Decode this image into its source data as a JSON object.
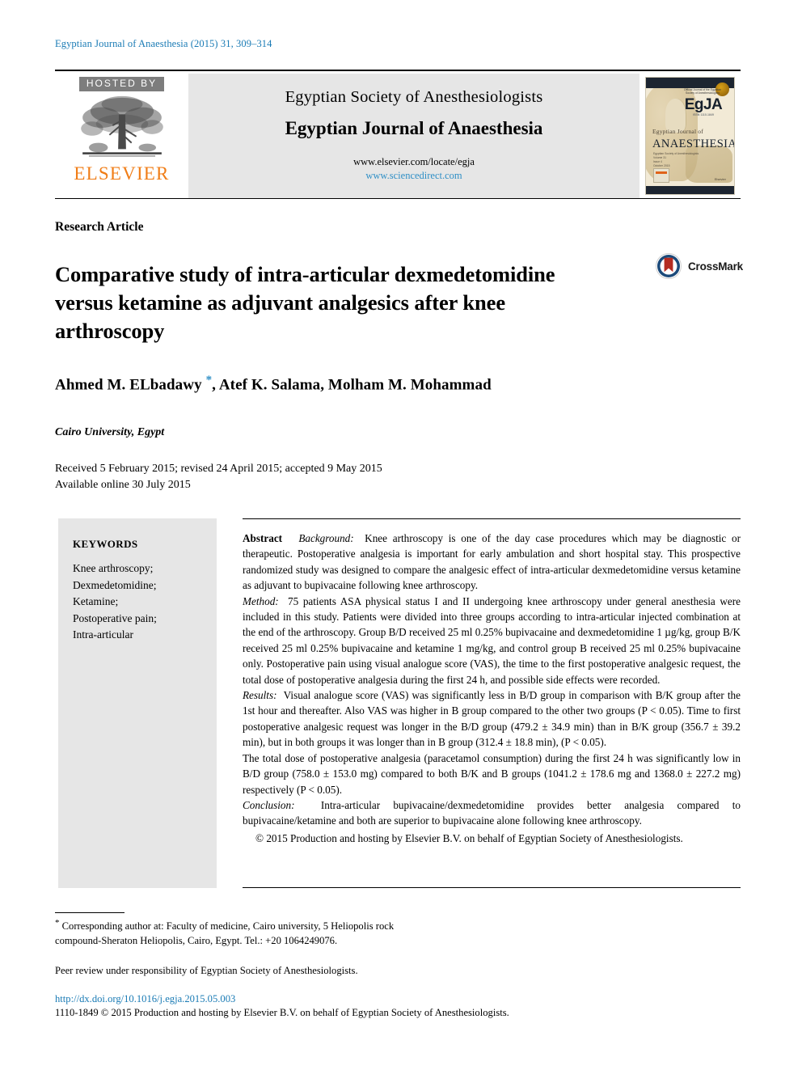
{
  "running_head": "Egyptian Journal of Anaesthesia (2015) 31, 309–314",
  "header": {
    "hosted_by": "HOSTED BY",
    "publisher_wordmark": "ELSEVIER",
    "society_name": "Egyptian Society of Anesthesiologists",
    "journal_name": "Egyptian Journal of Anaesthesia",
    "url_publisher": "www.elsevier.com/locate/egja",
    "url_platform": "www.sciencedirect.com",
    "cover": {
      "top_small": "Official Journal of the Egyptian Society of Anesthesiologists",
      "logo": "EgJA",
      "logo_sub": "ISSN 1110-1849",
      "title_line": "Egyptian Journal of",
      "title_main": "ANAESTHESIA",
      "meta_lines": "Egyptian Society of Anesthesiologists\nVolume 31\nIssue 4\nOctober 2015",
      "publisher_mini": "Elsevier"
    }
  },
  "article": {
    "type": "Research Article",
    "title": "Comparative study of intra-articular dexmedetomidine versus ketamine as adjuvant analgesics after knee arthroscopy",
    "crossmark_label": "CrossMark",
    "authors": "Ahmed M. ELbadawy ",
    "authors_rest": ", Atef K. Salama, Molham M. Mohammad",
    "corresponding_marker": "*",
    "affiliation": "Cairo University, Egypt",
    "history_received": "Received 5 February 2015; revised 24 April 2015; accepted 9 May 2015",
    "history_online": "Available online 30 July 2015"
  },
  "keywords": {
    "heading": "KEYWORDS",
    "items": [
      "Knee arthroscopy;",
      "Dexmedetomidine;",
      "Ketamine;",
      "Postoperative pain;",
      "Intra-articular"
    ]
  },
  "abstract": {
    "label": "Abstract",
    "background_label": "Background:",
    "background_text": "Knee arthroscopy is one of the day case procedures which may be diagnostic or therapeutic. Postoperative analgesia is important for early ambulation and short hospital stay. This prospective randomized study was designed to compare the analgesic effect of intra-articular dexmedetomidine versus ketamine as adjuvant to bupivacaine following knee arthroscopy.",
    "method_label": "Method:",
    "method_text": "75 patients ASA physical status I and II undergoing knee arthroscopy under general anesthesia were included in this study. Patients were divided into three groups according to intra-articular injected combination at the end of the arthroscopy. Group B/D received 25 ml 0.25% bupivacaine and dexmedetomidine 1 µg/kg, group B/K received 25 ml 0.25% bupivacaine and ketamine 1 mg/kg, and control group B received 25 ml 0.25% bupivacaine only. Postoperative pain using visual analogue score (VAS), the time to the first postoperative analgesic request, the total dose of postoperative analgesia during the first 24 h, and possible side effects were recorded.",
    "results_label": "Results:",
    "results_text": "Visual analogue score (VAS) was significantly less in B/D group in comparison with B/K group after the 1st hour and thereafter. Also VAS was higher in B group compared to the other two groups (P < 0.05). Time to first postoperative analgesic request was longer in the B/D group (479.2 ± 34.9 min) than in B/K group (356.7 ± 39.2 min), but in both groups it was longer than in B group (312.4 ± 18.8 min), (P < 0.05).",
    "results_text2": "The total dose of postoperative analgesia (paracetamol consumption) during the first 24 h was significantly low in B/D group (758.0 ± 153.0 mg) compared to both B/K and B groups (1041.2 ± 178.6 mg and 1368.0 ± 227.2 mg) respectively (P < 0.05).",
    "conclusion_label": "Conclusion:",
    "conclusion_text": "Intra-articular bupivacaine/dexmedetomidine provides better analgesia compared to bupivacaine/ketamine and both are superior to bupivacaine alone following knee arthroscopy.",
    "copyright": "© 2015 Production and hosting by Elsevier B.V. on behalf of Egyptian Society of Anesthesiologists."
  },
  "footnotes": {
    "corresponding": "Corresponding author at: Faculty of medicine, Cairo university, 5 Heliopolis rock compound-Sheraton Heliopolis, Cairo, Egypt. Tel.: +20 1064249076.",
    "peer_review": "Peer review under responsibility of Egyptian Society of Anesthesiologists.",
    "doi": "http://dx.doi.org/10.1016/j.egja.2015.05.003",
    "issn_line": "1110-1849 © 2015 Production and hosting by Elsevier B.V. on behalf of Egyptian Society of Anesthesiologists."
  },
  "colors": {
    "link_blue": "#1a7bb5",
    "elsevier_orange": "#f07d17",
    "hosted_gray": "#7d7d7d",
    "panel_gray": "#e6e6e6",
    "crossmark_blue": "#1b4a7a",
    "crossmark_red": "#b42c22"
  }
}
